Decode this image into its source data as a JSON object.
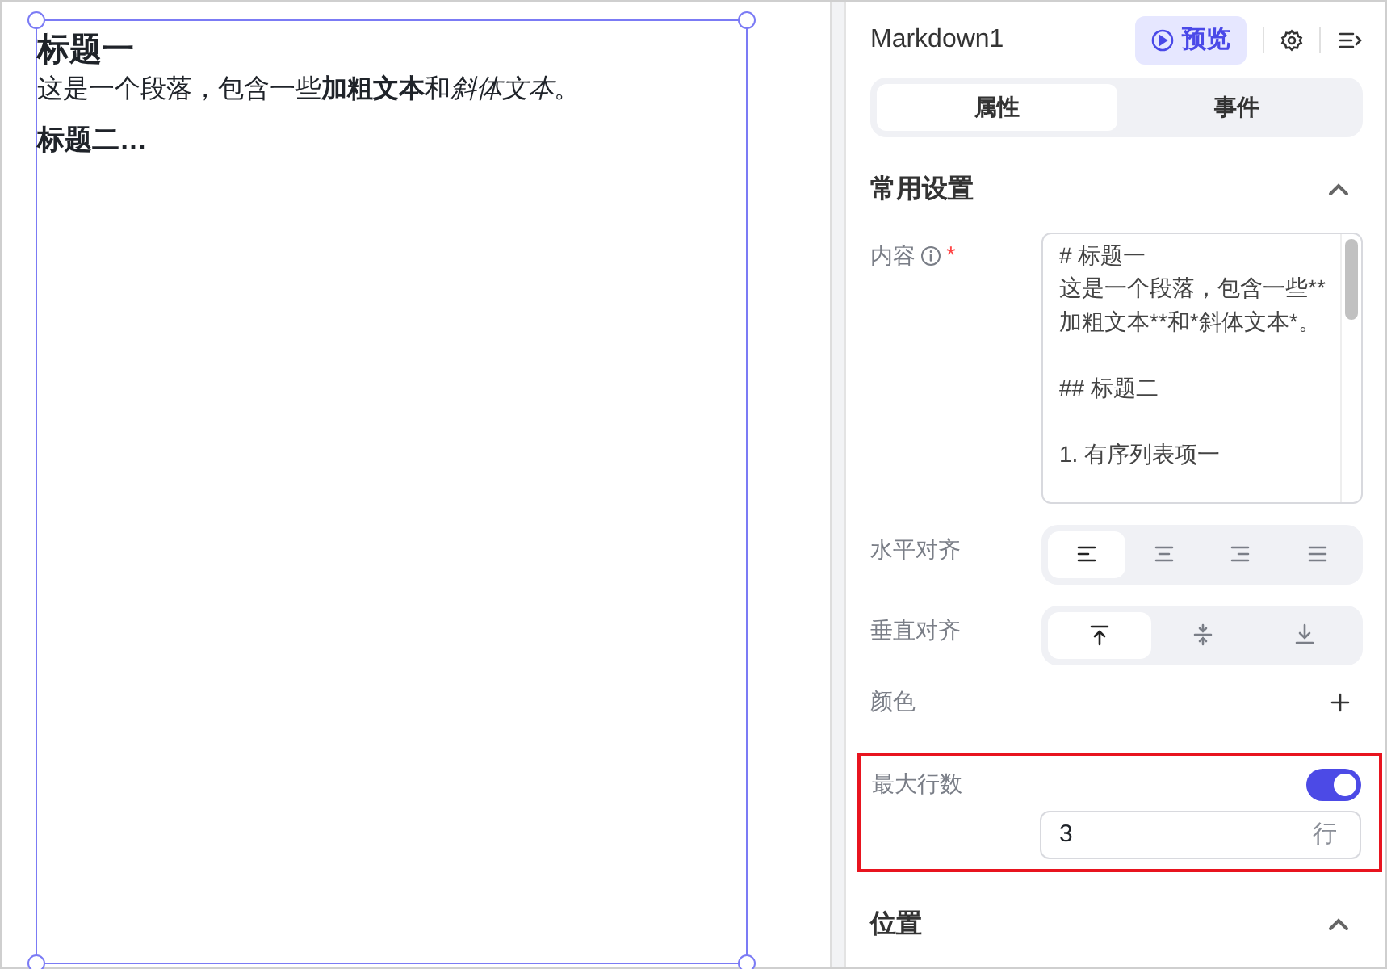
{
  "canvas": {
    "selected": true,
    "heading_1": "标题一",
    "paragraph": [
      {
        "text": "这是一个段落，包含一些",
        "kind": "plain"
      },
      {
        "text": "加粗文本",
        "kind": "bold"
      },
      {
        "text": "和",
        "kind": "plain"
      },
      {
        "text": "斜体文本",
        "kind": "italic"
      },
      {
        "text": "。",
        "kind": "plain"
      }
    ],
    "heading_2": "标题二…"
  },
  "panel": {
    "title": "Markdown1",
    "preview_button": "预览",
    "tabs": [
      {
        "label": "属性",
        "selected": true
      },
      {
        "label": "事件",
        "selected": false
      }
    ],
    "section": {
      "title": "常用设置",
      "expanded": true
    },
    "content": {
      "label": "内容",
      "required_mark": "*",
      "paragraphs": [
        [
          "# 标题一",
          "这是一个段落，包含一些**加粗文本**和*斜体文本*。"
        ],
        [
          "## 标题二"
        ],
        [
          "1. 有序列表项一"
        ]
      ]
    },
    "horizontal_align": {
      "label": "水平对齐",
      "options": [
        {
          "kind": "left",
          "selected": true
        },
        {
          "kind": "center",
          "selected": false
        },
        {
          "kind": "right",
          "selected": false
        },
        {
          "kind": "justify",
          "selected": false
        }
      ]
    },
    "vertical_align": {
      "label": "垂直对齐",
      "options": [
        {
          "kind": "top",
          "selected": true
        },
        {
          "kind": "middle",
          "selected": false
        },
        {
          "kind": "bottom",
          "selected": false
        }
      ]
    },
    "color": {
      "label": "颜色"
    },
    "max_lines": {
      "label": "最大行数",
      "highlighted": true,
      "on": true,
      "value": "3",
      "unit": "行"
    },
    "position_section": {
      "title": "位置",
      "expanded": true
    }
  }
}
